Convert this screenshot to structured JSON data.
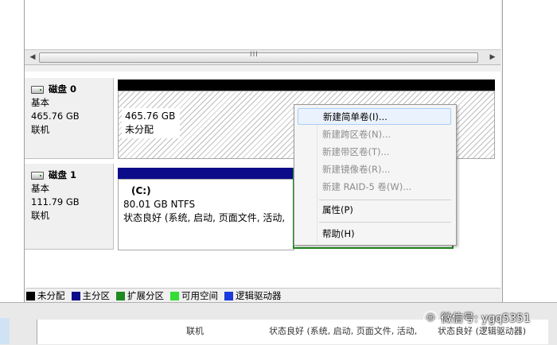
{
  "disks": [
    {
      "name": "磁盘 0",
      "type": "基本",
      "size": "465.76 GB",
      "status": "联机"
    },
    {
      "name": "磁盘 1",
      "type": "基本",
      "size": "111.79 GB",
      "status": "联机"
    }
  ],
  "unallocated": {
    "size": "465.76 GB",
    "label": "未分配"
  },
  "volume_c": {
    "name": "(C:)",
    "info": "80.01 GB NTFS",
    "status": "状态良好 (系统, 启动, 页面文件, 活动,"
  },
  "context_menu": {
    "items": [
      {
        "label": "新建简单卷(I)...",
        "enabled": true
      },
      {
        "label": "新建跨区卷(N)...",
        "enabled": false
      },
      {
        "label": "新建带区卷(T)...",
        "enabled": false
      },
      {
        "label": "新建镜像卷(R)...",
        "enabled": false
      },
      {
        "label": "新建 RAID-5 卷(W)...",
        "enabled": false
      },
      {
        "label": "属性(P)",
        "enabled": true
      },
      {
        "label": "帮助(H)",
        "enabled": true
      }
    ]
  },
  "legend": [
    {
      "label": "未分配",
      "color": "#000000"
    },
    {
      "label": "主分区",
      "color": "#0c0c8a"
    },
    {
      "label": "扩展分区",
      "color": "#1f8a1f"
    },
    {
      "label": "可用空间",
      "color": "#33dd33"
    },
    {
      "label": "逻辑驱动器",
      "color": "#1a3adb"
    }
  ],
  "bottom": {
    "col1": "联机",
    "col2": "状态良好 (系统, 启动, 页面文件, 活动,",
    "col3": "状态良好 (逻辑驱动器)"
  },
  "watermark": "微信号: ygq5351",
  "scrollbar_grip": "III"
}
